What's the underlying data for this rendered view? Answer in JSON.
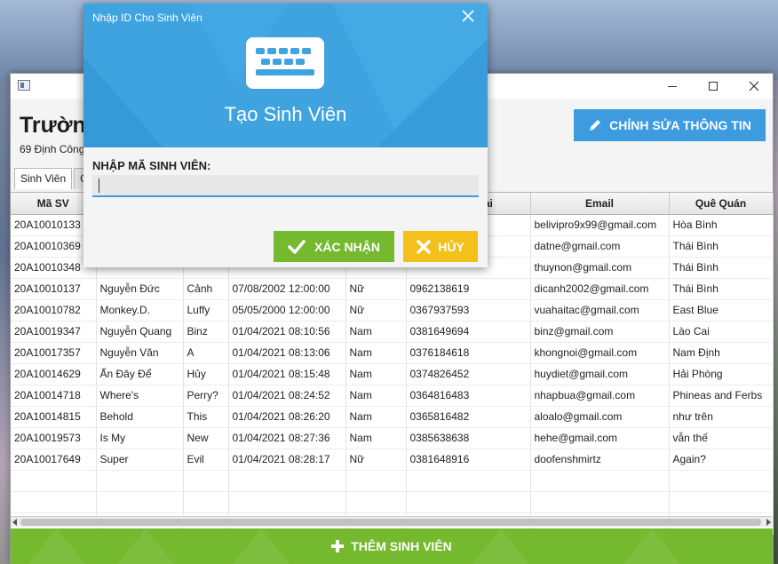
{
  "dialog": {
    "title": "Nhập ID Cho Sinh Viên",
    "heading": "Tạo Sinh Viên",
    "input_label": "NHẬP MÃ SINH VIÊN:",
    "input_value": "",
    "confirm_label": "XÁC NHẬN",
    "cancel_label": "HỦY",
    "close_icon": "close-icon",
    "header_color": "#3fa3e0"
  },
  "window": {
    "school_title": "Trườn",
    "school_address": "69 Định Công",
    "edit_button_label": "CHỈNH SỬA THÔNG TIN",
    "add_button_label": "THÊM SINH VIÊN"
  },
  "tabs": [
    {
      "label": "Sinh Viên"
    },
    {
      "label": "G"
    }
  ],
  "table": {
    "columns": [
      "Mã SV",
      "",
      "",
      "",
      "",
      "oại",
      "Email",
      "Quê Quán"
    ],
    "rows": [
      [
        "20A10010133",
        "",
        "",
        "",
        "",
        "",
        "belivipro9x99@gmail.com",
        "Hòa Bình"
      ],
      [
        "20A10010369",
        "",
        "",
        "",
        "",
        "",
        "datne@gmail.com",
        "Thái Bình"
      ],
      [
        "20A10010348",
        "",
        "",
        "",
        "",
        "",
        "thuynon@gmail.com",
        "Thái Bình"
      ],
      [
        "20A10010137",
        "Nguyễn Đức",
        "Cảnh",
        "07/08/2002 12:00:00",
        "Nữ",
        "0962138619",
        "dicanh2002@gmail.com",
        "Thái Bình"
      ],
      [
        "20A10010782",
        "Monkey.D.",
        "Luffy",
        "05/05/2000 12:00:00",
        "Nữ",
        "0367937593",
        "vuahaitac@gmail.com",
        "East Blue"
      ],
      [
        "20A10019347",
        "Nguyễn Quang",
        "Binz",
        "01/04/2021 08:10:56",
        "Nam",
        "0381649694",
        "binz@gmail.com",
        "Lào Cai"
      ],
      [
        "20A10017357",
        "Nguyễn Văn",
        "A",
        "01/04/2021 08:13:06",
        "Nam",
        "0376184618",
        "khongnoi@gmail.com",
        "Nam Định"
      ],
      [
        "20A10014629",
        "Ấn Đây Để",
        "Hủy",
        "01/04/2021 08:15:48",
        "Nam",
        "0374826452",
        "huydiet@gmail.com",
        "Hải Phòng"
      ],
      [
        "20A10014718",
        "Where's",
        "Perry?",
        "01/04/2021 08:24:52",
        "Nam",
        "0364816483",
        "nhapbua@gmail.com",
        "Phineas and Ferbs"
      ],
      [
        "20A10014815",
        "Behold",
        "This",
        "01/04/2021 08:26:20",
        "Nam",
        "0365816482",
        "aloalo@gmail.com",
        "như trên"
      ],
      [
        "20A10019573",
        "Is My",
        "New",
        "01/04/2021 08:27:36",
        "Nam",
        "0385638638",
        "hehe@gmail.com",
        "vẫn thế"
      ],
      [
        "20A10017649",
        "Super",
        "Evil",
        "01/04/2021 08:28:17",
        "Nữ",
        "0381648916",
        "doofenshmirtz",
        "Again?"
      ]
    ]
  },
  "colors": {
    "accent_blue": "#3d9be0",
    "accent_green": "#74b92e",
    "accent_yellow": "#f3c01c"
  }
}
